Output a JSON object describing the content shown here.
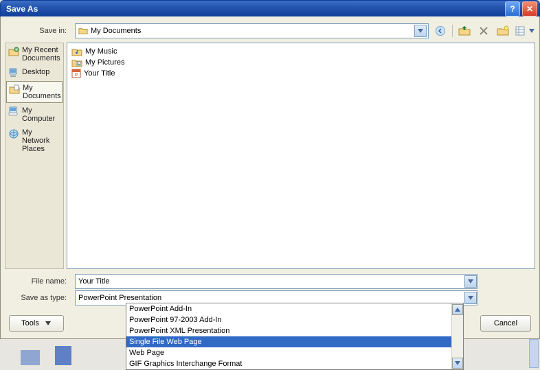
{
  "title": "Save As",
  "labels": {
    "save_in": "Save in:",
    "file_name": "File name:",
    "save_as_type": "Save as type:",
    "tools": "Tools",
    "cancel": "Cancel"
  },
  "save_in": {
    "selected": "My Documents"
  },
  "places": [
    {
      "label": "My Recent Documents"
    },
    {
      "label": "Desktop"
    },
    {
      "label": "My Documents"
    },
    {
      "label": "My Computer"
    },
    {
      "label": "My Network Places"
    }
  ],
  "places_selected_index": 2,
  "files": [
    {
      "name": "My Music",
      "kind": "music-folder"
    },
    {
      "name": "My Pictures",
      "kind": "pictures-folder"
    },
    {
      "name": "Your Title",
      "kind": "presentation"
    }
  ],
  "file_name_value": "Your Title",
  "save_as_type_value": "PowerPoint Presentation",
  "type_options": [
    "PowerPoint Add-In",
    "PowerPoint 97-2003 Add-In",
    "PowerPoint XML Presentation",
    "Single File Web Page",
    "Web Page",
    "GIF Graphics Interchange Format"
  ],
  "type_selected_index": 3
}
